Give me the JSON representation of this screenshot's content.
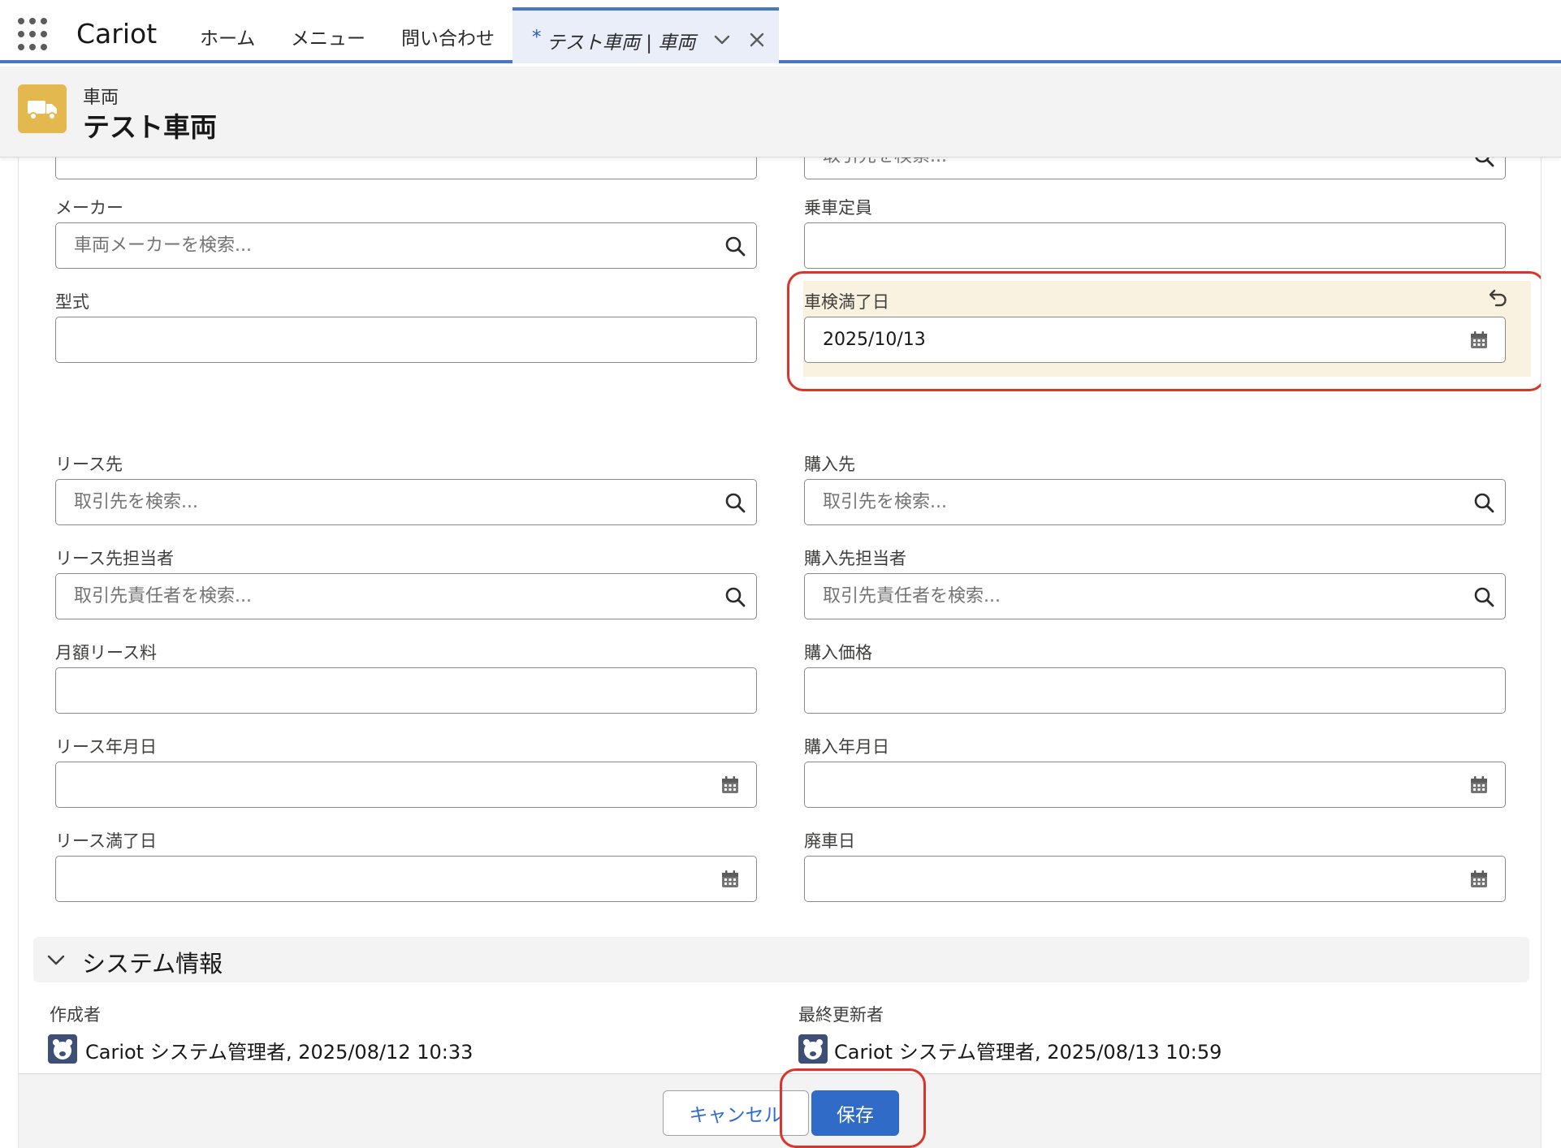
{
  "app": {
    "name": "Cariot"
  },
  "nav": {
    "items": [
      "ホーム",
      "メニュー",
      "問い合わせ"
    ],
    "active_tab": {
      "modified_marker": "*",
      "label": "テスト車両 | 車両"
    }
  },
  "record": {
    "object_type": "車両",
    "name": "テスト車両"
  },
  "form": {
    "top_left": {
      "value": ""
    },
    "top_right": {
      "placeholder": "取引先を検索..."
    },
    "maker": {
      "label": "メーカー",
      "placeholder": "車両メーカーを検索..."
    },
    "capacity": {
      "label": "乗車定員",
      "value": ""
    },
    "model": {
      "label": "型式",
      "value": ""
    },
    "inspection_expiry": {
      "label": "車検満了日",
      "value": "2025/10/13"
    },
    "lessor": {
      "label": "リース先",
      "placeholder": "取引先を検索..."
    },
    "purchase_from": {
      "label": "購入先",
      "placeholder": "取引先を検索..."
    },
    "lessor_contact": {
      "label": "リース先担当者",
      "placeholder": "取引先責任者を検索..."
    },
    "purchase_contact": {
      "label": "購入先担当者",
      "placeholder": "取引先責任者を検索..."
    },
    "monthly_lease_fee": {
      "label": "月額リース料",
      "value": ""
    },
    "purchase_price": {
      "label": "購入価格",
      "value": ""
    },
    "lease_date": {
      "label": "リース年月日",
      "value": ""
    },
    "purchase_date": {
      "label": "購入年月日",
      "value": ""
    },
    "lease_expiry": {
      "label": "リース満了日",
      "value": ""
    },
    "scrap_date": {
      "label": "廃車日",
      "value": ""
    }
  },
  "system_info": {
    "title": "システム情報",
    "created_by": {
      "label": "作成者",
      "value": "Cariot システム管理者, 2025/08/12 10:33"
    },
    "last_modified_by": {
      "label": "最終更新者",
      "value": "Cariot システム管理者, 2025/08/13 10:59"
    }
  },
  "footer": {
    "cancel_label": "キャンセル",
    "save_label": "保存"
  },
  "colors": {
    "brand_blue": "#2f6bc7",
    "edited_highlight": "#faf2e0",
    "annotation_red": "#d9352a",
    "object_icon": "#e3b94f"
  }
}
